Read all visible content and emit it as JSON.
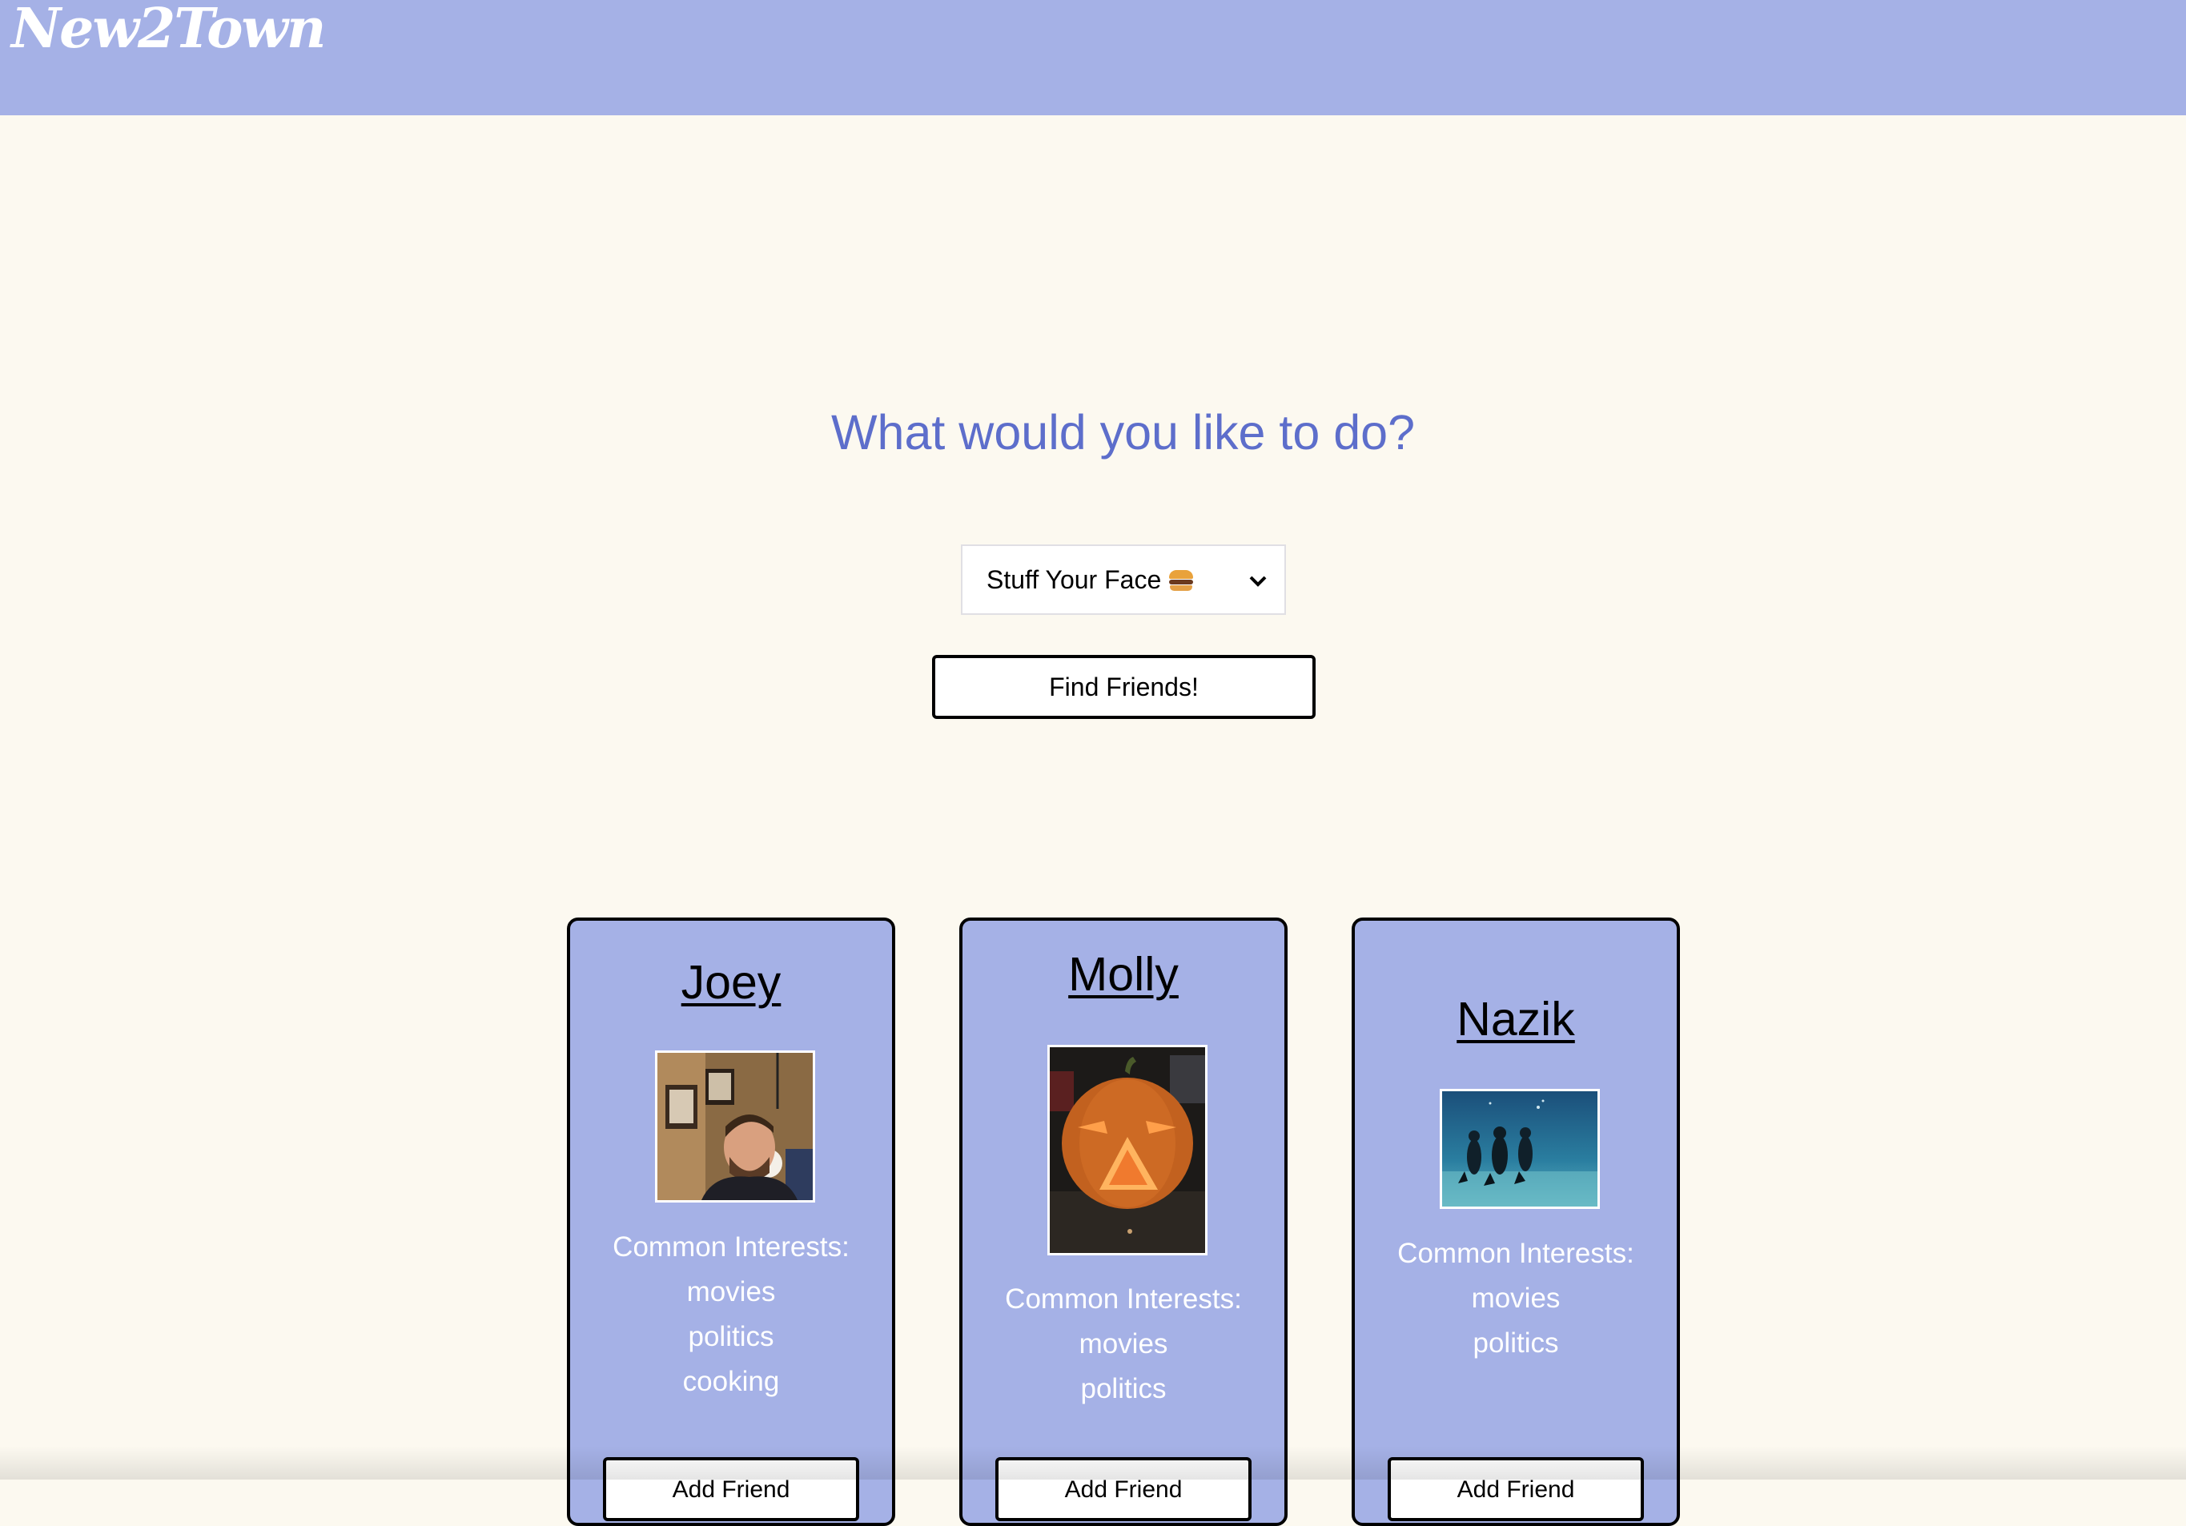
{
  "header": {
    "logo": "New2Town"
  },
  "main": {
    "prompt": "What would you like to do?",
    "activity_select": {
      "selected": "Stuff Your Face",
      "selected_icon": "hamburger-emoji"
    },
    "find_button_label": "Find Friends!"
  },
  "cards": [
    {
      "name": "Joey",
      "photo": "profile-photo-joey",
      "interests_heading": "Common Interests:",
      "interests": [
        "movies",
        "politics",
        "cooking"
      ],
      "button_label": "Add Friend"
    },
    {
      "name": "Molly",
      "photo": "profile-photo-molly",
      "interests_heading": "Common Interests:",
      "interests": [
        "movies",
        "politics"
      ],
      "button_label": "Add Friend"
    },
    {
      "name": "Nazik",
      "photo": "profile-photo-nazik",
      "interests_heading": "Common Interests:",
      "interests": [
        "movies",
        "politics"
      ],
      "button_label": "Add Friend"
    }
  ],
  "colors": {
    "header_bg": "#a5b1e6",
    "page_bg": "#fcf9f0",
    "prompt_text": "#5d6ecb",
    "card_bg": "#a5b1e6"
  }
}
